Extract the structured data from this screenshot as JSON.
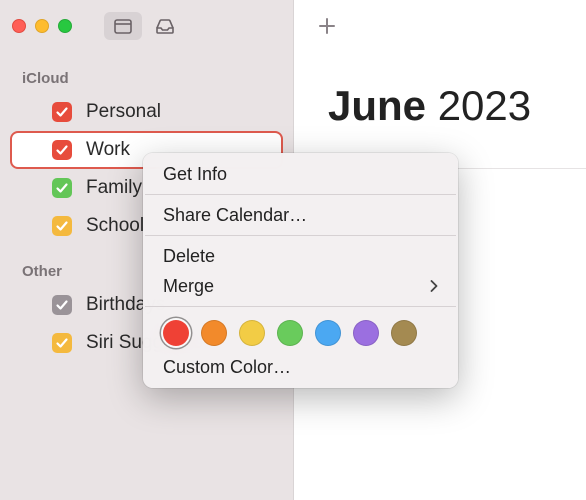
{
  "sidebar": {
    "sections": [
      {
        "title": "iCloud",
        "items": [
          {
            "label": "Personal",
            "color": "red",
            "selected": false
          },
          {
            "label": "Work",
            "color": "red",
            "selected": true
          },
          {
            "label": "Family",
            "color": "green",
            "selected": false
          },
          {
            "label": "School",
            "color": "yellow",
            "selected": false
          }
        ]
      },
      {
        "title": "Other",
        "items": [
          {
            "label": "Birthdays",
            "color": "gray",
            "selected": false
          },
          {
            "label": "Siri Suggestions",
            "color": "yellow",
            "selected": false
          }
        ]
      }
    ]
  },
  "main": {
    "month": "June",
    "year": "2023"
  },
  "context_menu": {
    "items": {
      "get_info": "Get Info",
      "share": "Share Calendar…",
      "delete": "Delete",
      "merge": "Merge",
      "custom_color": "Custom Color…"
    },
    "colors": [
      {
        "hex": "#ef4135",
        "selected": true
      },
      {
        "hex": "#f28a2b",
        "selected": false
      },
      {
        "hex": "#f2cc45",
        "selected": false
      },
      {
        "hex": "#69cb5c",
        "selected": false
      },
      {
        "hex": "#4ba8f2",
        "selected": false
      },
      {
        "hex": "#9b6fe0",
        "selected": false
      },
      {
        "hex": "#a48a51",
        "selected": false
      }
    ]
  }
}
